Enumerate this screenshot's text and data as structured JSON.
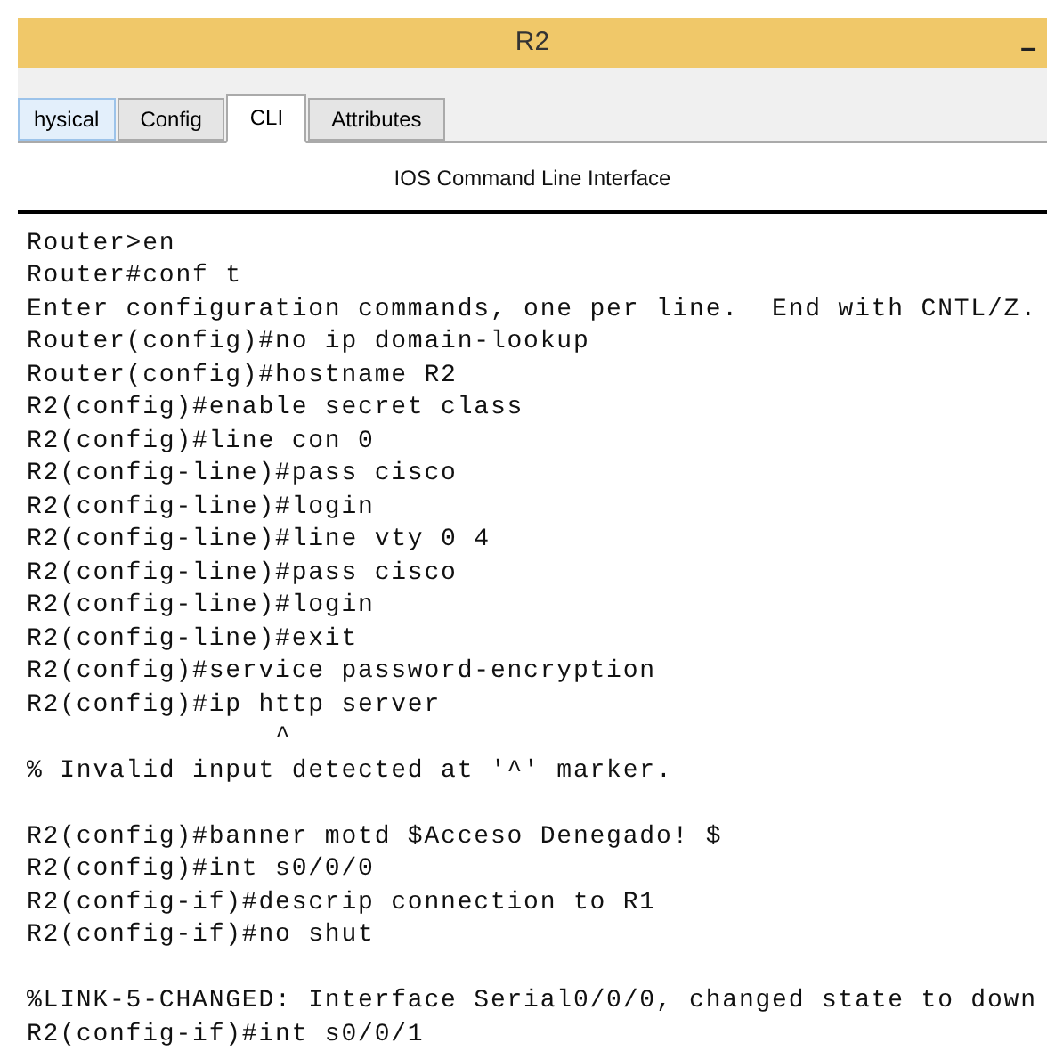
{
  "window": {
    "title": "R2",
    "minimize": "–"
  },
  "tabs": [
    {
      "label": "hysical",
      "selected": false
    },
    {
      "label": "Config",
      "selected": false
    },
    {
      "label": "CLI",
      "selected": true
    },
    {
      "label": "Attributes",
      "selected": false
    }
  ],
  "panel_title": "IOS Command Line Interface",
  "terminal_blocks": [
    [
      "Router>en",
      "Router#conf t",
      "Enter configuration commands, one per line.  End with CNTL/Z.",
      "Router(config)#no ip domain-lookup",
      "Router(config)#hostname R2",
      "R2(config)#enable secret class",
      "R2(config)#line con 0",
      "R2(config-line)#pass cisco",
      "R2(config-line)#login",
      "R2(config-line)#line vty 0 4",
      "R2(config-line)#pass cisco",
      "R2(config-line)#login",
      "R2(config-line)#exit",
      "R2(config)#service password-encryption",
      "R2(config)#ip http server",
      "               ^",
      "% Invalid input detected at '^' marker."
    ],
    [
      "R2(config)#banner motd $Acceso Denegado! $",
      "R2(config)#int s0/0/0",
      "R2(config-if)#descrip connection to R1",
      "R2(config-if)#no shut"
    ],
    [
      "%LINK-5-CHANGED: Interface Serial0/0/0, changed state to down",
      "R2(config-if)#int s0/0/1"
    ]
  ]
}
